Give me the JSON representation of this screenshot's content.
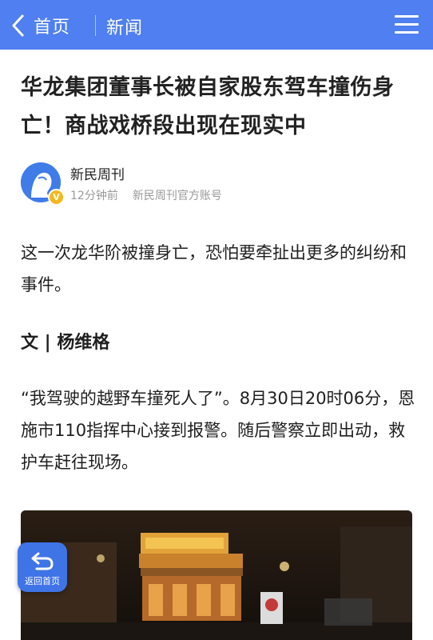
{
  "topbar": {
    "back_label": "首页",
    "title": "新闻",
    "accent_color": "#4f7ff0",
    "back_icon": "chevron-left-icon",
    "menu_icon": "hamburger-menu-icon"
  },
  "article": {
    "headline": "华龙集团董事长被自家股东驾车撞伤身亡！商战戏桥段出现在现实中",
    "author": {
      "name": "新民周刊",
      "time": "12分钟前",
      "account_type": "新民周刊官方账号",
      "badge_text": "V",
      "avatar_icon": "avatar-silhouette-icon"
    },
    "paragraphs": [
      "这一次龙华阶被撞身亡，恐怕要牵扯出更多的纠纷和事件。",
      "“我驾驶的越野车撞死人了”。8月30日20时06分，恩施市110指挥中心接到报警。随后警察立即出动，救护车赶往现场。"
    ],
    "byline": "文 | 杨维格"
  },
  "floating": {
    "return_home_label": "返回首页",
    "return_icon": "return-arrow-icon"
  }
}
